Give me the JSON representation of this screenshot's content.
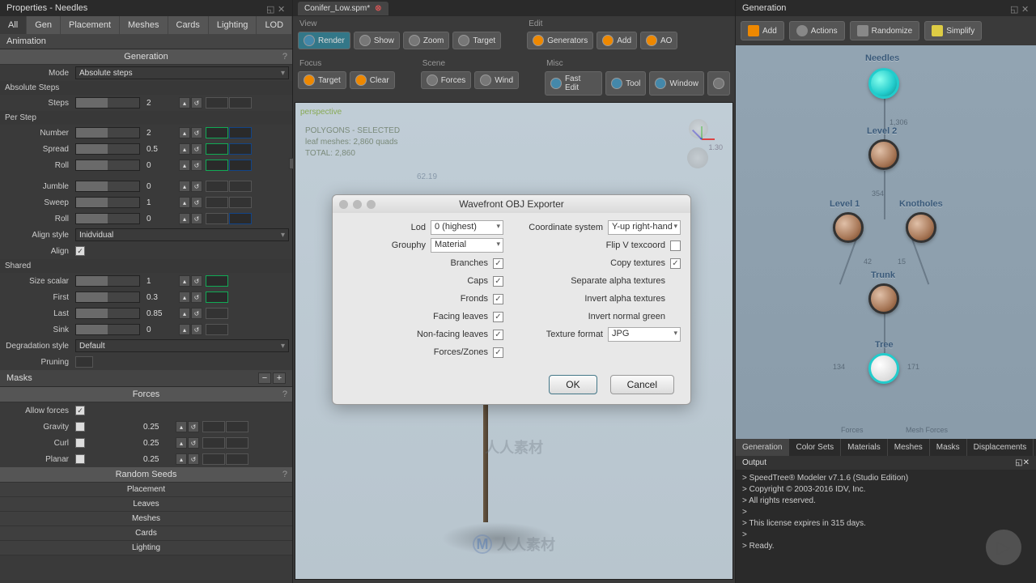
{
  "left": {
    "title": "Properties - Needles",
    "tabs": [
      "All",
      "Gen",
      "Placement",
      "Meshes",
      "Cards",
      "Lighting",
      "LOD"
    ],
    "animation": "Animation",
    "generation": "Generation",
    "mode_lbl": "Mode",
    "mode_val": "Absolute steps",
    "absolute_steps": "Absolute Steps",
    "steps_lbl": "Steps",
    "steps_val": "2",
    "per_step": "Per Step",
    "number_lbl": "Number",
    "number_val": "2",
    "spread_lbl": "Spread",
    "spread_val": "0.5",
    "roll_lbl": "Roll",
    "roll_val": "0",
    "jumble_lbl": "Jumble",
    "jumble_val": "0",
    "sweep_lbl": "Sweep",
    "sweep_val": "1",
    "roll2_lbl": "Roll",
    "roll2_val": "0",
    "alignstyle_lbl": "Align style",
    "alignstyle_val": "Inidvidual",
    "align_lbl": "Align",
    "shared": "Shared",
    "sizescalar_lbl": "Size scalar",
    "sizescalar_val": "1",
    "first_lbl": "First",
    "first_val": "0.3",
    "last_lbl": "Last",
    "last_val": "0.85",
    "sink_lbl": "Sink",
    "sink_val": "0",
    "degrad_lbl": "Degradation style",
    "degrad_val": "Default",
    "pruning_lbl": "Pruning",
    "masks": "Masks",
    "forces": "Forces",
    "allowforces_lbl": "Allow forces",
    "gravity_lbl": "Gravity",
    "gravity_val": "0.25",
    "curl_lbl": "Curl",
    "curl_val": "0.25",
    "planar_lbl": "Planar",
    "planar_val": "0.25",
    "seeds": "Random Seeds",
    "seed_rows": [
      "Placement",
      "Leaves",
      "Meshes",
      "Cards",
      "Lighting"
    ]
  },
  "center": {
    "filename": "Conifer_Low.spm*",
    "grp_view": "View",
    "btn_render": "Render",
    "btn_show": "Show",
    "btn_zoom": "Zoom",
    "btn_target": "Target",
    "grp_edit": "Edit",
    "btn_generators": "Generators",
    "btn_add": "Add",
    "btn_ao": "AO",
    "grp_focus": "Focus",
    "btn_ftarget": "Target",
    "btn_clear": "Clear",
    "grp_scene": "Scene",
    "btn_forces": "Forces",
    "btn_wind": "Wind",
    "grp_misc": "Misc",
    "btn_fastedit": "Fast Edit",
    "btn_tool": "Tool",
    "btn_window": "Window",
    "vp_label": "perspective",
    "stats_hdr": "POLYGONS - SELECTED",
    "stats_l1": "leaf meshes: 2,860 quads",
    "stats_l2": "TOTAL: 2,860",
    "dim": "62.19",
    "scale": "1.30"
  },
  "dialog": {
    "title": "Wavefront OBJ Exporter",
    "lod_lbl": "Lod",
    "lod_val": "0 (highest)",
    "grouphy_lbl": "Grouphy",
    "grouphy_val": "Material",
    "branches_lbl": "Branches",
    "caps_lbl": "Caps",
    "fronds_lbl": "Fronds",
    "facing_lbl": "Facing leaves",
    "nonfacing_lbl": "Non-facing leaves",
    "forceszones_lbl": "Forces/Zones",
    "coord_lbl": "Coordinate system",
    "coord_val": "Y-up right-hand",
    "flipv_lbl": "Flip V texcoord",
    "copytex_lbl": "Copy textures",
    "sepalpha_lbl": "Separate alpha textures",
    "invalpha_lbl": "Invert alpha textures",
    "invnorm_lbl": "Invert normal green",
    "texfmt_lbl": "Texture format",
    "texfmt_val": "JPG",
    "ok": "OK",
    "cancel": "Cancel"
  },
  "right": {
    "title": "Generation",
    "btn_add": "Add",
    "btn_actions": "Actions",
    "btn_random": "Randomize",
    "btn_simplify": "Simplify",
    "node_needles": "Needles",
    "node_level2": "Level 2",
    "node_level1": "Level 1",
    "node_knot": "Knotholes",
    "node_trunk": "Trunk",
    "node_tree": "Tree",
    "e1": "1,306",
    "e2": "354",
    "e3": "42",
    "e4": "15",
    "e_lf": "134",
    "e_lf2": "171",
    "ft_forces": "Forces",
    "ft_mesh": "Mesh Forces",
    "btm_tabs": [
      "Generation",
      "Color Sets",
      "Materials",
      "Meshes",
      "Masks",
      "Displacements"
    ],
    "output": "Output",
    "lines": [
      "> SpeedTree® Modeler v7.1.6 (Studio Edition)",
      "> Copyright © 2003-2016 IDV, Inc.",
      "> All rights reserved.",
      ">",
      "> This license expires in 315 days.",
      ">",
      "> Ready."
    ]
  }
}
